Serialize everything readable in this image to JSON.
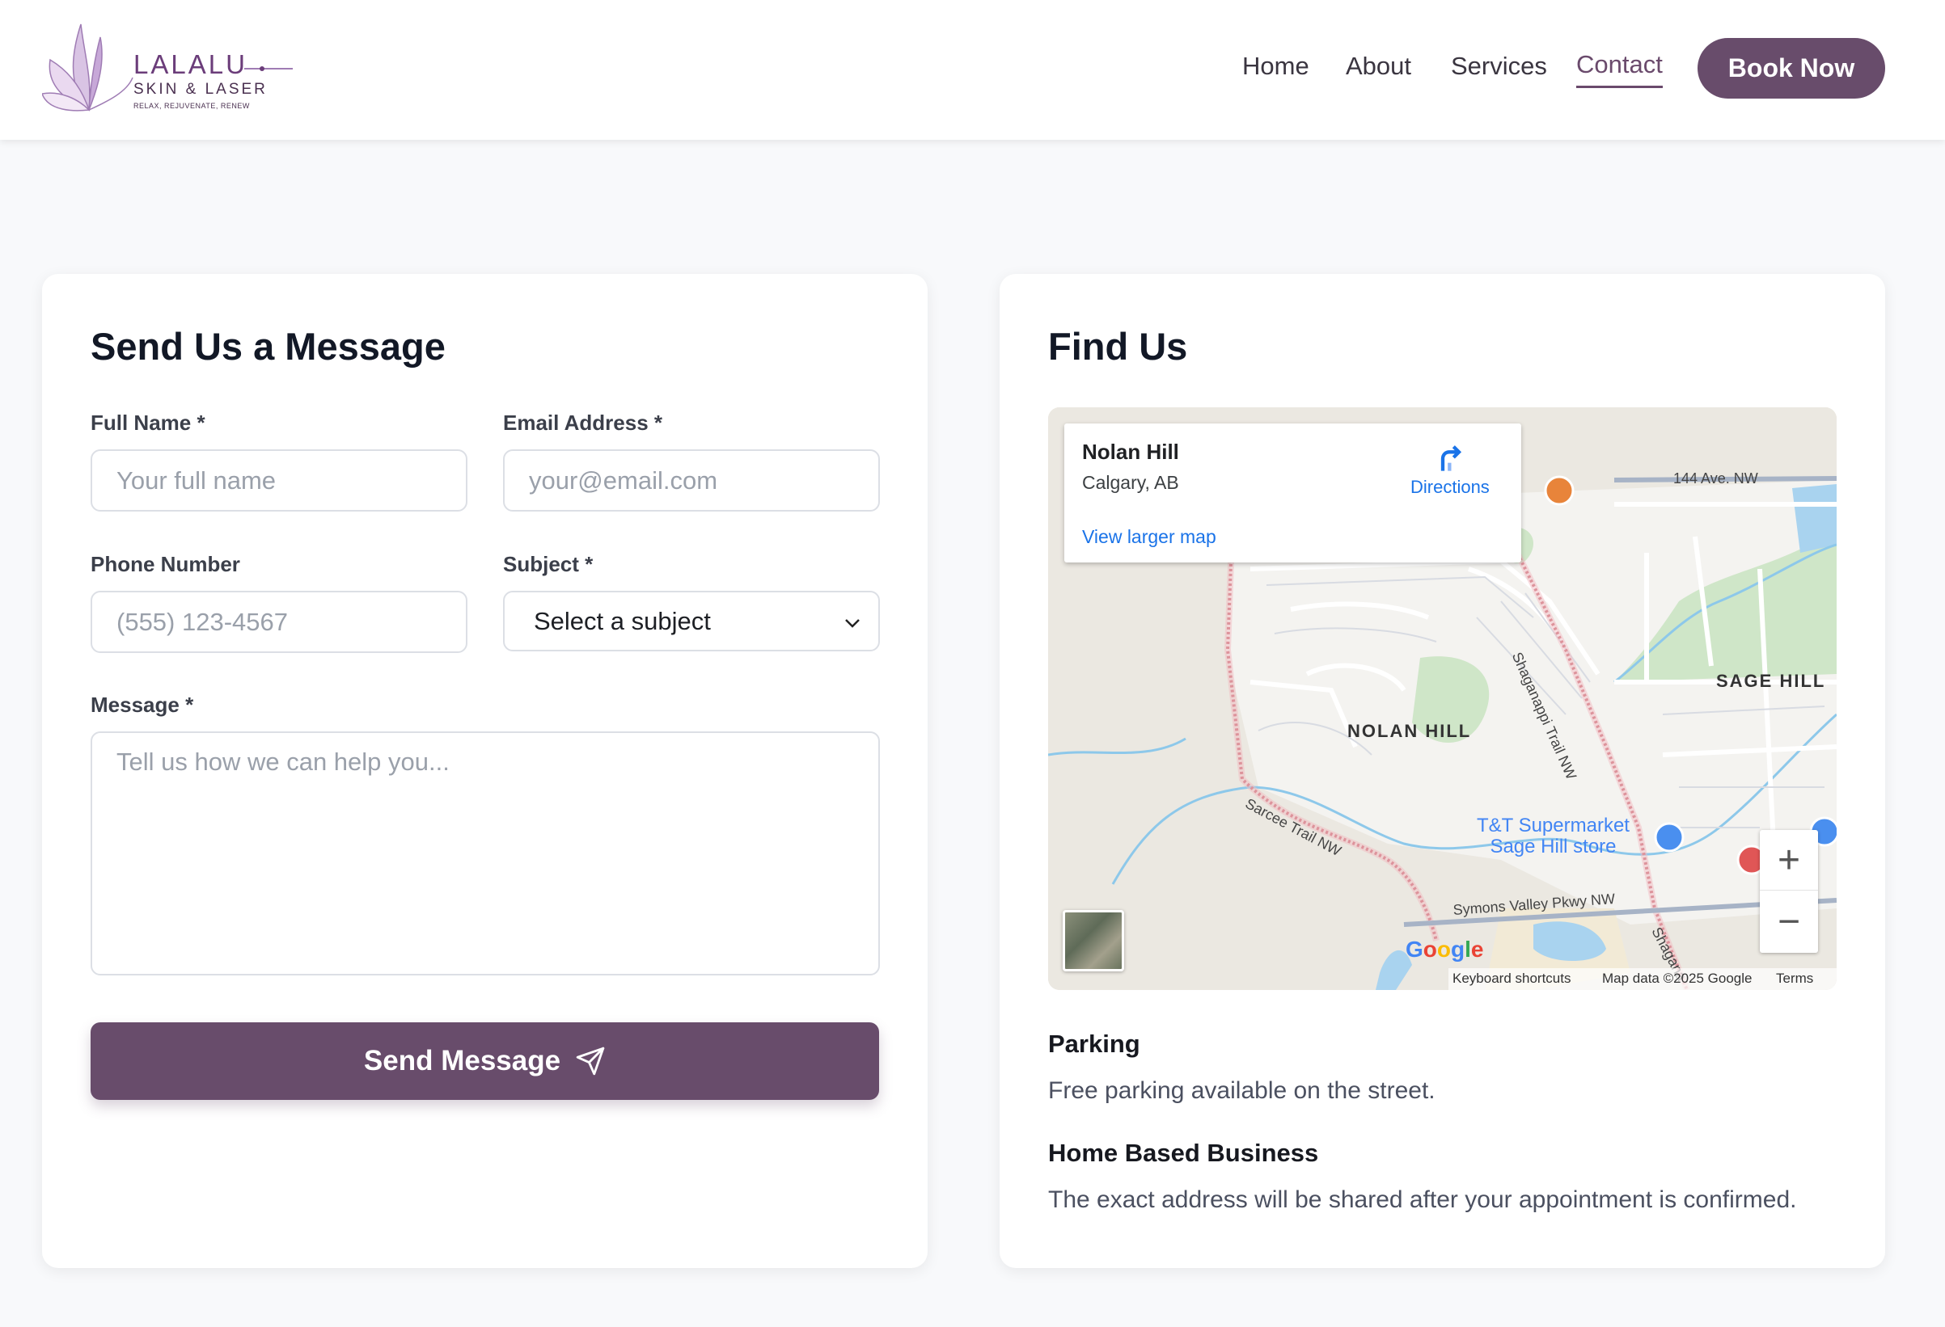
{
  "header": {
    "logo": {
      "name": "LALALU",
      "subtitle": "SKIN & LASER",
      "tagline": "RELAX, REJUVENATE, RENEW"
    },
    "nav": [
      {
        "label": "Home",
        "active": false
      },
      {
        "label": "About",
        "active": false
      },
      {
        "label": "Services",
        "active": false
      },
      {
        "label": "Contact",
        "active": true
      }
    ],
    "cta": "Book Now"
  },
  "contact_form": {
    "title": "Send Us a Message",
    "full_name": {
      "label": "Full Name *",
      "placeholder": "Your full name"
    },
    "email": {
      "label": "Email Address *",
      "placeholder": "your@email.com"
    },
    "phone": {
      "label": "Phone Number",
      "placeholder": "(555) 123-4567"
    },
    "subject": {
      "label": "Subject *",
      "selected": "Select a subject"
    },
    "message": {
      "label": "Message *",
      "placeholder": "Tell us how we can help you..."
    },
    "submit": "Send Message"
  },
  "find_us": {
    "title": "Find Us",
    "map": {
      "place": "Nolan Hill",
      "city": "Calgary, AB",
      "directions": "Directions",
      "view_larger": "View larger map",
      "labels": {
        "nolan_hill": "NOLAN HILL",
        "sage_hill": "SAGE HILL",
        "ave_144": "144 Ave. NW",
        "shaganappi": "Shaganappi Trail NW",
        "sarcee": "Sarcee Trail NW",
        "symons": "Symons Valley Pkwy NW",
        "shagan_short": "Shagana",
        "poi_tt_1": "T&T Supermarket",
        "poi_tt_2": "Sage Hill store"
      },
      "google": "Google",
      "attribution": {
        "shortcuts": "Keyboard shortcuts",
        "data": "Map data ©2025 Google",
        "terms": "Terms"
      },
      "zoom_in": "+",
      "zoom_out": "−"
    },
    "parking": {
      "heading": "Parking",
      "text": "Free parking available on the street."
    },
    "home_business": {
      "heading": "Home Based Business",
      "text": "The exact address will be shared after your appointment is confirmed."
    }
  },
  "colors": {
    "brand": "#684c6b",
    "link": "#1a73e8"
  }
}
